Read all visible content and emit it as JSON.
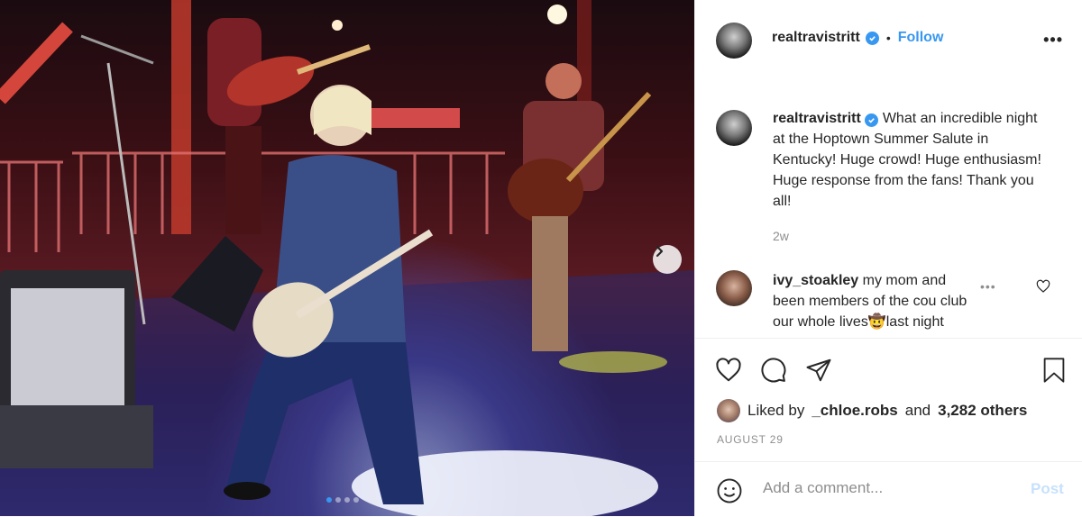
{
  "post": {
    "username": "realtravistritt",
    "follow_label": "Follow",
    "separator": "•",
    "more_label": "•••"
  },
  "caption": {
    "username": "realtravistritt",
    "text": "What an incredible night at the Hoptown Summer Salute in Kentucky! Huge crowd! Huge enthusiasm! Huge response from the fans! Thank you all!",
    "time": "2w"
  },
  "comments": [
    {
      "username": "ivy_stoakley",
      "text": "my mom and been members of the cou club our whole lives🤠last night",
      "more": "•••"
    }
  ],
  "likes": {
    "prefix": "Liked by",
    "user": "_chloe.robs",
    "middle": "and",
    "count": "3,282 others"
  },
  "date": "AUGUST 29",
  "comment_box": {
    "placeholder": "Add a comment...",
    "post_label": "Post"
  },
  "carousel": {
    "total": 4,
    "active": 0
  },
  "colors": {
    "accent": "#3897f0",
    "muted": "#8e8e8e",
    "post_disabled": "#c7e1fc"
  },
  "icons": [
    "verified-icon",
    "heart-icon",
    "comment-icon",
    "share-icon",
    "bookmark-icon",
    "emoji-icon",
    "chevron-right-icon"
  ]
}
